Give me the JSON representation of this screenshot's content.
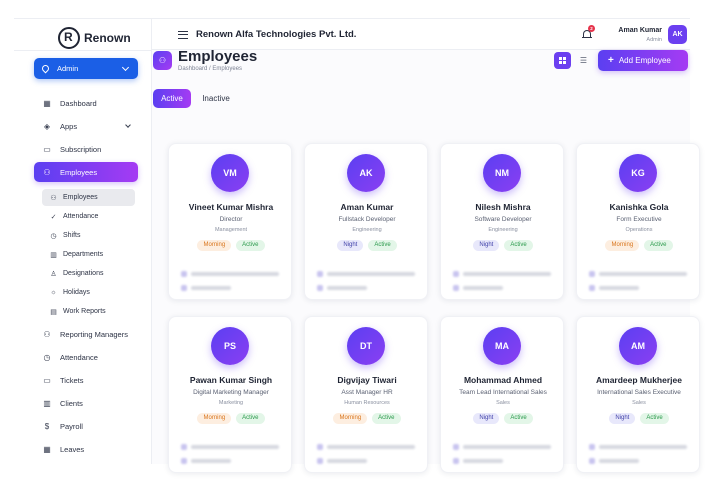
{
  "brand": {
    "name": "Renown"
  },
  "sidebar": {
    "role_select": "Admin",
    "items": [
      {
        "label": "Dashboard",
        "icon": "grid-icon"
      },
      {
        "label": "Apps",
        "icon": "box-icon",
        "expandable": true
      },
      {
        "label": "Subscription",
        "icon": "card-icon"
      },
      {
        "label": "Employees",
        "icon": "users-icon",
        "active": true
      },
      {
        "label": "Reporting Managers",
        "icon": "users-icon"
      },
      {
        "label": "Attendance",
        "icon": "clock-icon"
      },
      {
        "label": "Tickets",
        "icon": "ticket-icon"
      },
      {
        "label": "Clients",
        "icon": "building-icon"
      },
      {
        "label": "Payroll",
        "icon": "dollar-icon"
      },
      {
        "label": "Leaves",
        "icon": "calendar-icon"
      }
    ],
    "subitems": [
      {
        "label": "Employees",
        "icon": "users-icon",
        "active": true
      },
      {
        "label": "Attendance",
        "icon": "user-check-icon"
      },
      {
        "label": "Shifts",
        "icon": "clock-icon"
      },
      {
        "label": "Departments",
        "icon": "building-icon"
      },
      {
        "label": "Designations",
        "icon": "badge-icon"
      },
      {
        "label": "Holidays",
        "icon": "sun-icon"
      },
      {
        "label": "Work Reports",
        "icon": "chart-icon"
      }
    ]
  },
  "topbar": {
    "company": "Renown Alfa Technologies Pvt. Ltd.",
    "notification_count": "2",
    "user_name": "Aman Kumar",
    "user_role": "Admin",
    "user_initials": "AK"
  },
  "page": {
    "title": "Employees",
    "breadcrumb": "Dashboard / Employees",
    "add_button": "Add Employee",
    "tabs": {
      "active": "Active",
      "inactive": "Inactive"
    }
  },
  "employees": [
    {
      "initials": "VM",
      "name": "Vineet Kumar Mishra",
      "role": "Director",
      "dept": "Management",
      "shift": "Morning",
      "status": "Active"
    },
    {
      "initials": "AK",
      "name": "Aman Kumar",
      "role": "Fullstack Developer",
      "dept": "Engineering",
      "shift": "Night",
      "status": "Active"
    },
    {
      "initials": "NM",
      "name": "Nilesh Mishra",
      "role": "Software Developer",
      "dept": "Engineering",
      "shift": "Night",
      "status": "Active"
    },
    {
      "initials": "KG",
      "name": "Kanishka Gola",
      "role": "Form Executive",
      "dept": "Operations",
      "shift": "Morning",
      "status": "Active"
    },
    {
      "initials": "PS",
      "name": "Pawan Kumar Singh",
      "role": "Digital Marketing Manager",
      "dept": "Marketing",
      "shift": "Morning",
      "status": "Active"
    },
    {
      "initials": "DT",
      "name": "Digvijay Tiwari",
      "role": "Asst Manager HR",
      "dept": "Human Resources",
      "shift": "Morning",
      "status": "Active"
    },
    {
      "initials": "MA",
      "name": "Mohammad Ahmed",
      "role": "Team Lead International Sales",
      "dept": "Sales",
      "shift": "Night",
      "status": "Active"
    },
    {
      "initials": "AM",
      "name": "Amardeep Mukherjee",
      "role": "International Sales Executive",
      "dept": "Sales",
      "shift": "Night",
      "status": "Active"
    }
  ]
}
